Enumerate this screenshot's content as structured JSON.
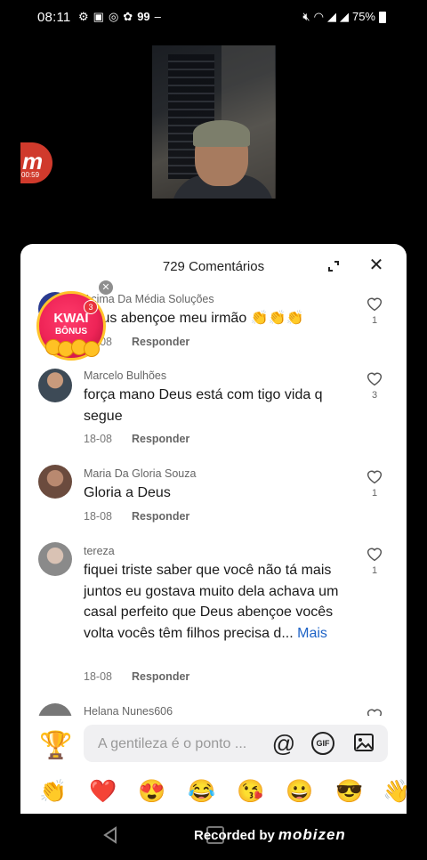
{
  "status_bar": {
    "time": "08:11",
    "app_badge_count": "99",
    "battery": "75%"
  },
  "floating": {
    "mobizen_timer": "00:59",
    "kwai_label": "KWAI",
    "kwai_sub": "BÔNUS",
    "kwai_badge": "3"
  },
  "panel": {
    "title": "729 Comentários"
  },
  "comments": [
    {
      "user": "Acima Da Média Soluções",
      "text": "Deus abençoe meu irmão 👏👏👏",
      "date": "18-08",
      "reply": "Responder",
      "likes": "1"
    },
    {
      "user": "Marcelo Bulhões",
      "text": "força mano Deus está com tigo vida q segue",
      "date": "18-08",
      "reply": "Responder",
      "likes": "3"
    },
    {
      "user": "Maria Da Gloria Souza",
      "text": "Gloria a Deus",
      "date": "18-08",
      "reply": "Responder",
      "likes": "1"
    },
    {
      "user": "tereza",
      "text": "fiquei triste saber que você não tá mais juntos eu gostava muito dela achava um casal perfeito que Deus abençoe vocês volta vocês têm filhos precisa d...",
      "more": "Mais",
      "date": "18-08",
      "reply": "Responder",
      "likes": "1"
    },
    {
      "user": "Helana Nunes606"
    }
  ],
  "input": {
    "placeholder": "A gentileza é o ponto ..."
  },
  "emojis": [
    "👏",
    "❤️",
    "😍",
    "😂",
    "😘",
    "😀",
    "😎",
    "👋"
  ],
  "navbar": {
    "recorded_label": "Recorded by",
    "recorded_brand": "mobizen"
  }
}
